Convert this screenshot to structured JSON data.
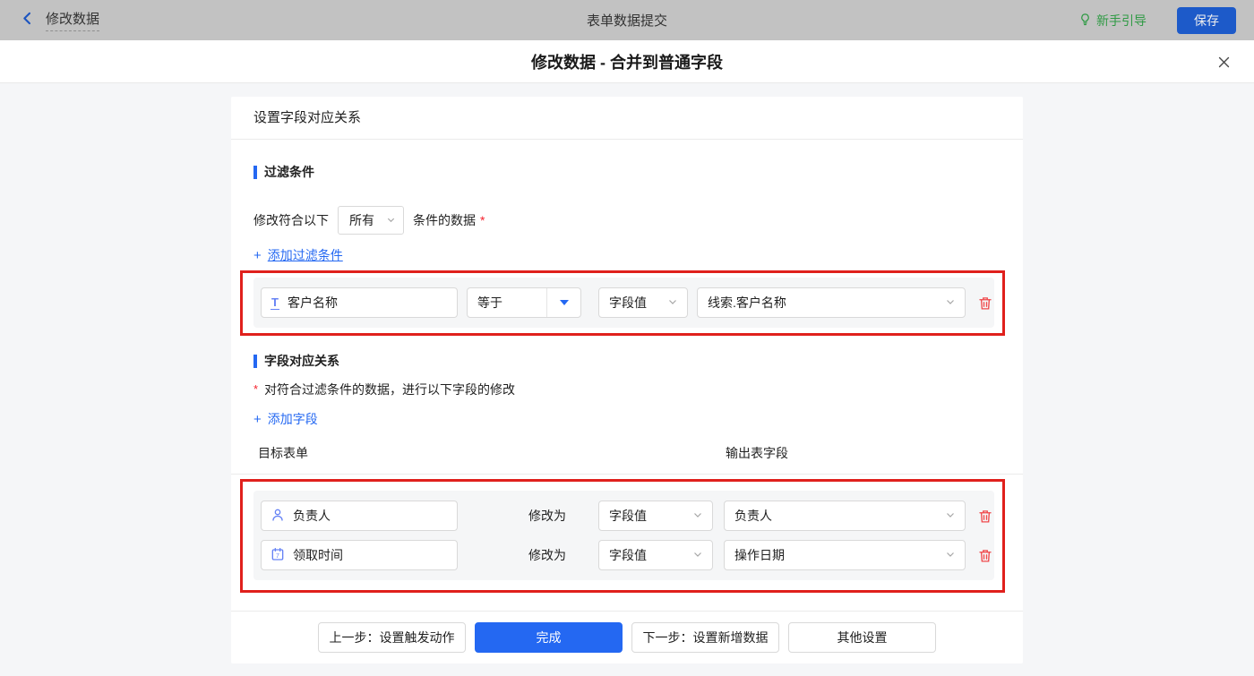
{
  "top_bar": {
    "back_label": "修改数据",
    "center_title": "表单数据提交",
    "guide_label": "新手引导",
    "save_label": "保存"
  },
  "dialog": {
    "title": "修改数据 - 合并到普通字段"
  },
  "card": {
    "header_title": "设置字段对应关系",
    "filter": {
      "section_title": "过滤条件",
      "condition_prefix": "修改符合以下",
      "condition_value": "所有",
      "condition_suffix": "条件的数据",
      "required_mark": "*",
      "add_plus": "+",
      "add_label": "添加过滤条件",
      "row": {
        "field_icon": "T",
        "field": "客户名称",
        "operator": "等于",
        "value_type": "字段值",
        "value": "线索.客户名称"
      }
    },
    "mapping": {
      "section_title": "字段对应关系",
      "required_mark": "*",
      "description": "对符合过滤条件的数据，进行以下字段的修改",
      "add_plus": "+",
      "add_label": "添加字段",
      "col_target": "目标表单",
      "col_output": "输出表字段",
      "modify_label": "修改为",
      "rows": [
        {
          "icon": "user-icon",
          "field": "负责人",
          "value_type": "字段值",
          "value": "负责人"
        },
        {
          "icon": "calendar-icon",
          "field": "领取时间",
          "value_type": "字段值",
          "value": "操作日期"
        }
      ]
    },
    "footer": {
      "prev_label": "上一步：设置触发动作",
      "done_label": "完成",
      "next_label": "下一步：设置新增数据",
      "other_label": "其他设置"
    }
  },
  "colors": {
    "accent_blue": "#2468f2",
    "annotation_red": "#e0201c",
    "danger_red": "#f0484b",
    "required_red": "#f5222d",
    "guide_green": "#2f9a44",
    "topbar_dim_gray": "#c2c2c2",
    "field_icon_blue": "#6582f5",
    "panel_gray": "#f5f6f7"
  }
}
